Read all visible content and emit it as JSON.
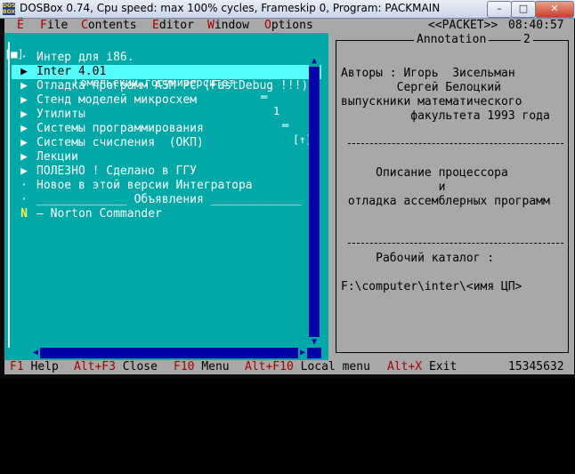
{
  "window": {
    "title": "DOSBox 0.74, Cpu speed: max 100% cycles, Frameskip  0, Program: PACKMAIN",
    "app_icon": "DOS BOX",
    "minimize": "–",
    "maximize": "□",
    "close": "✕"
  },
  "menu": {
    "items": [
      {
        "hot": "Ё",
        "rest": ""
      },
      {
        "hot": "F",
        "rest": "ile"
      },
      {
        "hot": "C",
        "rest": "ontents"
      },
      {
        "hot": "E",
        "rest": "ditor"
      },
      {
        "hot": "W",
        "rest": "indow"
      },
      {
        "hot": "O",
        "rest": "ptions"
      }
    ],
    "packet": "<<PACKET>>",
    "clock": "08:40:57"
  },
  "win1": {
    "title": "Гомельский госуниверситет",
    "number": "1",
    "close_box": "[■]",
    "zoom_box": "[↑]",
    "items": [
      {
        "mark": "·",
        "label": "Интер для i86."
      },
      {
        "mark": "▶",
        "label": "Inter 4.01",
        "selected": true
      },
      {
        "mark": "▶",
        "label": "Отладка программ ASM PC (FastDebug !!!)"
      },
      {
        "mark": "▶",
        "label": "Стенд моделей микросхем"
      },
      {
        "mark": "▶",
        "label": "Утилиты"
      },
      {
        "mark": "▶",
        "label": "Системы программирования"
      },
      {
        "mark": "▶",
        "label": "Системы счисления  (ОКП)"
      },
      {
        "mark": "▶",
        "label": "Лекции"
      },
      {
        "mark": "▶",
        "label": "ПОЛЕЗНО ! Сделано в ГГУ"
      },
      {
        "mark": "·",
        "label": "Новое в этой версии Интегратора"
      },
      {
        "mark": "·",
        "label": "_____________ Объявления _____________"
      },
      {
        "mark": "N",
        "label": "– Norton Commander",
        "hot": true
      }
    ]
  },
  "win2": {
    "title": "Annotation",
    "number": "2",
    "lines": [
      "Авторы : Игорь  Зисельман",
      "        Сергей Белоцкий",
      "выпускники математического",
      "          факультета 1993 года",
      "",
      "",
      "",
      "",
      "     Описание процессора",
      "              и",
      " отладка ассемблерных программ",
      "",
      "",
      "",
      "",
      "     Рабочий каталог :",
      "",
      "",
      "F:\\computer\\inter\\<имя ЦП>"
    ]
  },
  "statusbar": {
    "keys": [
      {
        "key": "F1",
        "label": "Help"
      },
      {
        "key": "Alt+F3",
        "label": "Close"
      },
      {
        "key": "F10",
        "label": "Menu"
      },
      {
        "key": "Alt+F10",
        "label": "Local menu"
      },
      {
        "key": "Alt+X",
        "label": "Exit"
      }
    ],
    "memory": "15345632"
  },
  "colors": {
    "menu_bg": "#a8a8a8",
    "hotkey": "#a80000",
    "win1_bg": "#00a8a8",
    "selected_bg": "#54fcfc",
    "scroll_bg": "#0000a8"
  }
}
